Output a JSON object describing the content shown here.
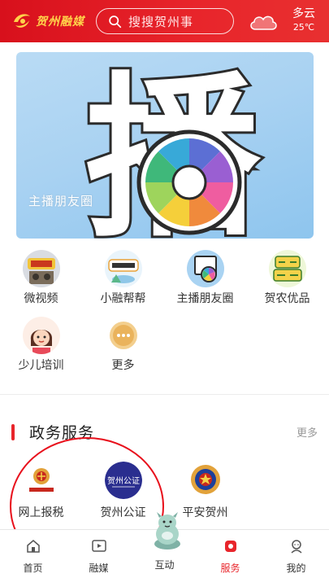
{
  "header": {
    "logo_text": "贺州融媒",
    "search_placeholder": "搜搜贺州事",
    "weather": {
      "condition": "多云",
      "temperature": "25℃",
      "icon": "cloud-icon"
    }
  },
  "banner": {
    "glyph": "播",
    "caption": "主播朋友圈"
  },
  "quick_links": [
    {
      "label": "微视频",
      "icon": "micro-video-icon"
    },
    {
      "label": "小融帮帮",
      "icon": "xiaorong-helper-icon"
    },
    {
      "label": "主播朋友圈",
      "icon": "anchor-circle-icon"
    },
    {
      "label": "贺农优品",
      "icon": "hecnong-products-icon"
    },
    {
      "label": "少儿培训",
      "icon": "kids-training-icon"
    },
    {
      "label": "更多",
      "icon": "more-dots-icon"
    }
  ],
  "gov_services": {
    "title": "政务服务",
    "more": "更多",
    "items": [
      {
        "label": "网上报税",
        "icon": "tax-emblem-icon"
      },
      {
        "label": "贺州公证",
        "icon": "notary-icon",
        "badge_text": "贺州公证"
      },
      {
        "label": "平安贺州",
        "icon": "police-emblem-icon"
      }
    ]
  },
  "tabbar": {
    "items": [
      {
        "label": "首页",
        "icon": "home-icon",
        "active": false
      },
      {
        "label": "融媒",
        "icon": "media-icon",
        "active": false
      },
      {
        "label": "互动",
        "icon": "interact-mascot-icon",
        "active": false
      },
      {
        "label": "服务",
        "icon": "service-icon",
        "active": true
      },
      {
        "label": "我的",
        "icon": "profile-icon",
        "active": false
      }
    ]
  },
  "colors": {
    "brand_red": "#e8252b",
    "accent_gold": "#ffd24a"
  }
}
